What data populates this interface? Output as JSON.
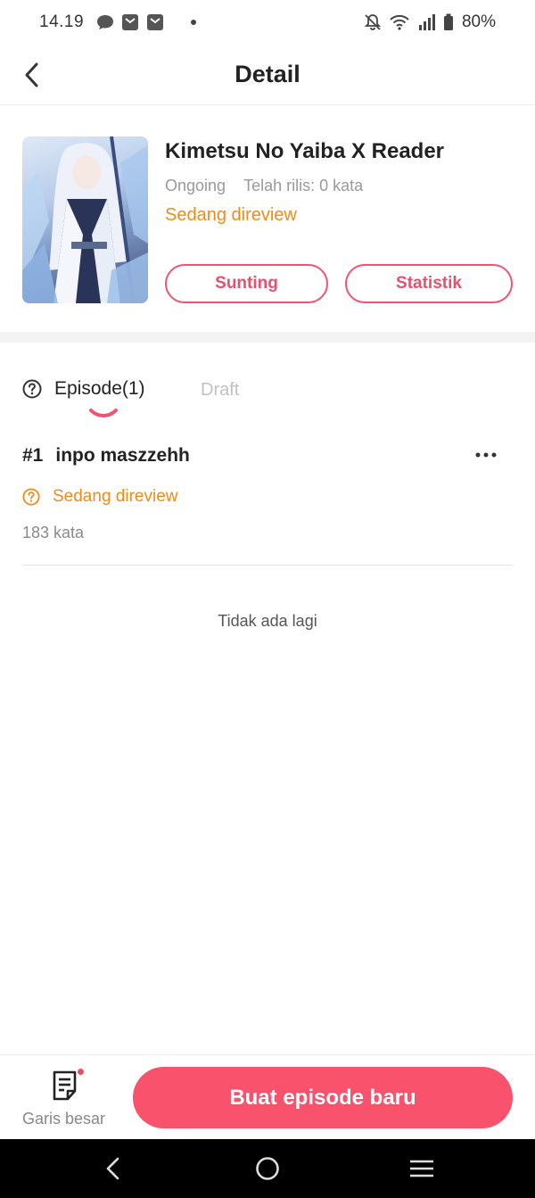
{
  "status_bar": {
    "time": "14.19",
    "battery": "80%",
    "icons": [
      "chat-bubble-icon",
      "mail-icon",
      "mail-icon",
      "mute-icon",
      "wifi-icon",
      "signal-icon",
      "battery-icon"
    ]
  },
  "header": {
    "title": "Detail",
    "back_icon": "chevron-left-icon"
  },
  "book": {
    "title": "Kimetsu No Yaiba X Reader",
    "status": "Ongoing",
    "published": "Telah rilis: 0 kata",
    "review_status": "Sedang direview",
    "edit_label": "Sunting",
    "stats_label": "Statistik"
  },
  "tabs": {
    "episode_label": "Episode(1)",
    "draft_label": "Draft"
  },
  "episodes": [
    {
      "number": "#1",
      "title": "inpo maszzehh",
      "status": "Sedang direview",
      "words": "183 kata"
    }
  ],
  "list_end": "Tidak ada lagi",
  "bottom_bar": {
    "outline_label": "Garis besar",
    "new_episode_label": "Buat episode baru"
  },
  "colors": {
    "accent": "#f8526c",
    "review": "#f08c1a",
    "muted": "#9a9a9a"
  }
}
